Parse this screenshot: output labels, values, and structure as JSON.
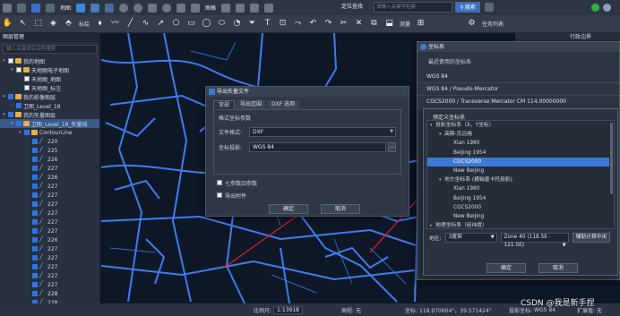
{
  "menu": {
    "items": [
      "",
      "",
      "",
      "",
      "地图",
      "",
      "",
      "",
      "",
      "",
      "",
      "",
      "",
      "",
      "图格",
      "",
      "",
      "",
      ""
    ],
    "search_mode": "定位查找",
    "search_placeholder": "请输入关键字检索",
    "search_btn": "搜索",
    "task": "任务列表"
  },
  "toolbar": {
    "label_a": "标绘",
    "label_b": "测量"
  },
  "panel": {
    "title": "图层管理",
    "filter_placeholder": "输入关键词后名称搜索",
    "tree": [
      {
        "lvl": 0,
        "tog": "▾",
        "cb": false,
        "kind": "folder",
        "label": "我的地图"
      },
      {
        "lvl": 1,
        "tog": "▾",
        "cb": false,
        "kind": "folder",
        "label": "天地图电子地图"
      },
      {
        "lvl": 2,
        "tog": "",
        "cb": false,
        "kind": "none",
        "label": "天地图_地图"
      },
      {
        "lvl": 2,
        "tog": "",
        "cb": false,
        "kind": "none",
        "label": "天地图_标注"
      },
      {
        "lvl": 0,
        "tog": "▾",
        "cb": true,
        "kind": "folder",
        "label": "我的影像图层"
      },
      {
        "lvl": 1,
        "tog": "›",
        "cb": true,
        "kind": "none",
        "label": "卫图_Level_18"
      },
      {
        "lvl": 0,
        "tog": "▾",
        "cb": true,
        "kind": "folder",
        "label": "我的矢量图层"
      },
      {
        "lvl": 1,
        "tog": "▾",
        "cb": true,
        "kind": "folder",
        "label": "卫图_Level_18_矢量线",
        "sel": true
      },
      {
        "lvl": 2,
        "tog": "▾",
        "cb": true,
        "kind": "folder",
        "label": "ContourLine"
      },
      {
        "lvl": 3,
        "tog": "",
        "cb": true,
        "kind": "line",
        "label": "220"
      },
      {
        "lvl": 3,
        "tog": "",
        "cb": true,
        "kind": "line",
        "label": "225"
      },
      {
        "lvl": 3,
        "tog": "",
        "cb": true,
        "kind": "line",
        "label": "226"
      },
      {
        "lvl": 3,
        "tog": "",
        "cb": true,
        "kind": "line",
        "label": "227"
      },
      {
        "lvl": 3,
        "tog": "",
        "cb": true,
        "kind": "line",
        "label": "226"
      },
      {
        "lvl": 3,
        "tog": "",
        "cb": true,
        "kind": "line",
        "label": "227"
      },
      {
        "lvl": 3,
        "tog": "",
        "cb": true,
        "kind": "line",
        "label": "227"
      },
      {
        "lvl": 3,
        "tog": "",
        "cb": true,
        "kind": "line",
        "label": "227"
      },
      {
        "lvl": 3,
        "tog": "",
        "cb": true,
        "kind": "line",
        "label": "227"
      },
      {
        "lvl": 3,
        "tog": "",
        "cb": true,
        "kind": "line",
        "label": "227"
      },
      {
        "lvl": 3,
        "tog": "",
        "cb": true,
        "kind": "line",
        "label": "227"
      },
      {
        "lvl": 3,
        "tog": "",
        "cb": true,
        "kind": "line",
        "label": "226"
      },
      {
        "lvl": 3,
        "tog": "",
        "cb": true,
        "kind": "line",
        "label": "227"
      },
      {
        "lvl": 3,
        "tog": "",
        "cb": true,
        "kind": "line",
        "label": "227"
      },
      {
        "lvl": 3,
        "tog": "",
        "cb": true,
        "kind": "line",
        "label": "227"
      },
      {
        "lvl": 3,
        "tog": "",
        "cb": true,
        "kind": "line",
        "label": "227"
      },
      {
        "lvl": 3,
        "tog": "",
        "cb": true,
        "kind": "line",
        "label": "227"
      },
      {
        "lvl": 3,
        "tog": "",
        "cb": true,
        "kind": "line",
        "label": "228"
      },
      {
        "lvl": 3,
        "tog": "",
        "cb": true,
        "kind": "line",
        "label": "228"
      },
      {
        "lvl": 3,
        "tog": "",
        "cb": true,
        "kind": "line",
        "label": "228"
      }
    ]
  },
  "export_dialog": {
    "title": "导出矢量文件",
    "tabs": [
      "常规",
      "导出范围",
      "DXF 选项"
    ],
    "group_title": "格式坐标参数",
    "format_label": "文件格式:",
    "format_value": "DXF",
    "crs_label": "坐标投影:",
    "crs_value": "WGS 84",
    "chk1": "七参数四参数",
    "chk2": "导出附件",
    "ok": "确定",
    "cancel": "取消"
  },
  "crs_dialog": {
    "title": "坐标系",
    "recent_label": "最近使用的坐标系",
    "recent": [
      "WGS 84",
      "WGS 84 / Pseudo-Mercator",
      "CGCS2000 / Transverse Mercator CM 114.00000000"
    ]
  },
  "predefined": {
    "title": "预定义坐标系",
    "rows": [
      {
        "ind": 0,
        "tg": "▾",
        "label": "投影坐标系（X，Y坐标）"
      },
      {
        "ind": 1,
        "tg": "▾",
        "label": "高斯-克吕格"
      },
      {
        "ind": 2,
        "tg": "",
        "label": "Xian 1980"
      },
      {
        "ind": 2,
        "tg": "",
        "label": "Beijing 1954"
      },
      {
        "ind": 2,
        "tg": "",
        "label": "CGCS2000",
        "sel": true
      },
      {
        "ind": 2,
        "tg": "",
        "label": "New Beijing"
      },
      {
        "ind": 1,
        "tg": "▾",
        "label": "地方坐标系 (横轴墨卡托投影)"
      },
      {
        "ind": 2,
        "tg": "",
        "label": "Xian 1980"
      },
      {
        "ind": 2,
        "tg": "",
        "label": "Beijing 1954"
      },
      {
        "ind": 2,
        "tg": "",
        "label": "CGCS2000"
      },
      {
        "ind": 2,
        "tg": "",
        "label": "New Beijing"
      },
      {
        "ind": 0,
        "tg": "▸",
        "label": "地理坐标系（经纬度）"
      }
    ],
    "zone_label": "地区:",
    "zone_type": "3度带",
    "zone_value": "Zone 40 (118.5E - 121.5E)",
    "calc_btn": "辅助计算中央",
    "ok": "确定",
    "cancel": "取消"
  },
  "right_pane": {
    "title": "行政边界"
  },
  "status": {
    "scale_label": "比例尺:",
    "scale": "1:13918",
    "elev_label": "高程:",
    "elev": "无",
    "coord_label": "坐标:",
    "coord": "118.970604°，39.571424°",
    "proj_label": "投影坐标:",
    "proj": "WGS 84",
    "extra_label": "扩展值:",
    "extra": "无"
  },
  "watermark": "CSDN @我是新手捏",
  "colors": {
    "road": "#3f7cf0",
    "arrow": "#e0202a",
    "accent": "#3b7bd6"
  }
}
